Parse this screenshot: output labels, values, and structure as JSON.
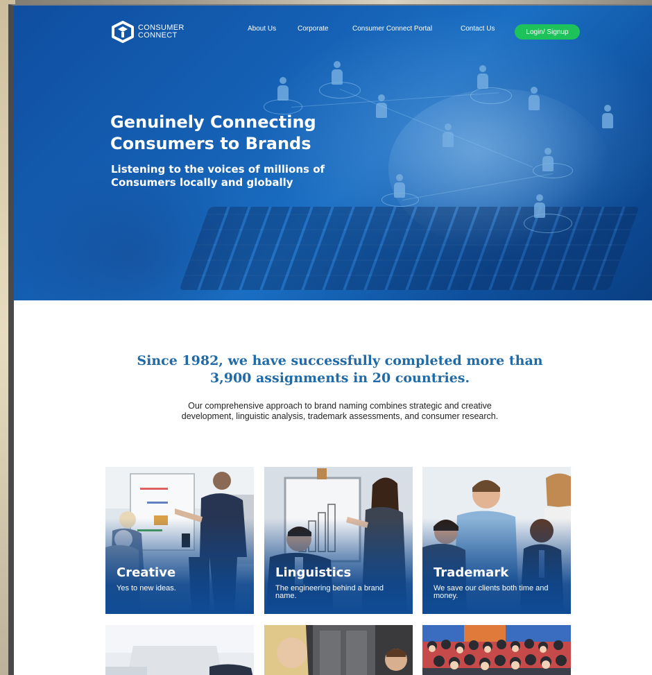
{
  "brand": {
    "logo_line1": "CONSUMER",
    "logo_line2": "CONNECT"
  },
  "nav": {
    "items": [
      {
        "label": "About Us"
      },
      {
        "label": "Corporate"
      },
      {
        "label": "Consumer Connect Portal"
      },
      {
        "label": "Contact Us"
      }
    ],
    "login_label": "Login/ Signup",
    "login_color": "#1ec25a"
  },
  "hero": {
    "title": "Genuinely Connecting Consumers to Brands",
    "subtitle": "Listening to the voices of millions of Consumers locally and globally"
  },
  "intro": {
    "headline": "Since 1982, we have successfully completed more than 3,900 assignments in 20 countries.",
    "body": "Our comprehensive approach to brand naming combines strategic and creative development, linguistic analysis, trademark assessments, and consumer research."
  },
  "cards": [
    {
      "title": "Creative",
      "description": "Yes to new ideas."
    },
    {
      "title": "Linguistics",
      "description": "The engineering behind a brand name."
    },
    {
      "title": "Trademark",
      "description": "We save our clients both time and money."
    }
  ],
  "colors": {
    "hero_blue": "#1560b4",
    "headline_blue": "#1f6aa7",
    "card_overlay": "#0f4c95"
  }
}
